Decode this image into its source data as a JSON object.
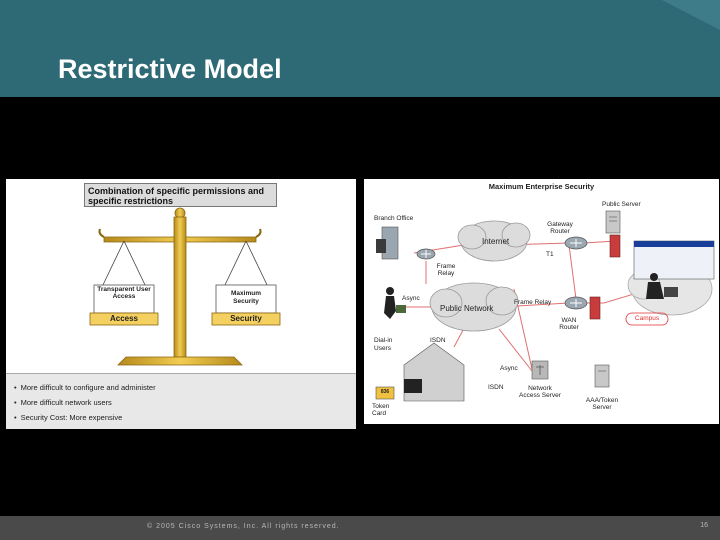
{
  "slide": {
    "title": "Restrictive Model",
    "footer_copyright": "© 2005 Cisco Systems, Inc. All rights reserved.",
    "page_number": "16"
  },
  "scale_panel": {
    "combo_box": "Combination of specific permissions and specific restrictions",
    "left_pan": {
      "label": "Transparent User Access",
      "tag": "Access"
    },
    "right_pan": {
      "label": "Maximum Security",
      "tag": "Security"
    },
    "bullets": [
      "More difficult to configure and administer",
      "More difficult network users",
      "Security Cost: More expensive"
    ]
  },
  "network_panel": {
    "title": "Maximum Enterprise Security",
    "labels": {
      "public_server": "Public Server",
      "branch_office": "Branch Office",
      "gateway_router": "Gateway Router",
      "internet": "Internet",
      "t1": "T1",
      "frame_relay_1": "Frame Relay",
      "async_1": "Async",
      "public_network": "Public Network",
      "frame_relay_2": "Frame Relay",
      "wan_router": "WAN Router",
      "campus": "Campus",
      "dialin_users": "Dial-in Users",
      "isdn_1": "ISDN",
      "async_2": "Async",
      "isdn_2": "ISDN",
      "token_card": "Token Card",
      "token_digits": "836",
      "nas": "Network Access Server",
      "aaa_server": "AAA/Token Server"
    }
  },
  "colors": {
    "header": "#2e6a75",
    "background": "#000000",
    "footer": "#4a4a4a",
    "access_tag": "#f4d060",
    "security_tag": "#f4d060",
    "campus_label": "#e03030",
    "link_line": "#e07070"
  }
}
